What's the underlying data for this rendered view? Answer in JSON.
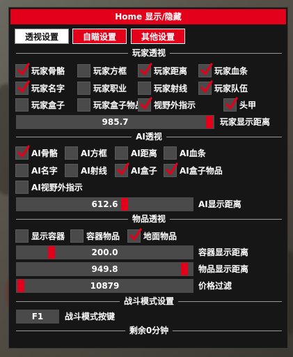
{
  "window": {
    "title": "Home 显示/隐藏"
  },
  "tabs": [
    {
      "label": "透视设置",
      "active": true
    },
    {
      "label": "自瞄设置",
      "active": false
    },
    {
      "label": "其他设置",
      "active": false
    }
  ],
  "player_section": {
    "title": "玩家透视",
    "options": [
      {
        "label": "玩家骨骼",
        "checked": true
      },
      {
        "label": "玩家方框",
        "checked": false
      },
      {
        "label": "玩家距离",
        "checked": true
      },
      {
        "label": "玩家血条",
        "checked": true
      },
      {
        "label": "玩家名字",
        "checked": true
      },
      {
        "label": "玩家职业",
        "checked": false
      },
      {
        "label": "玩家射线",
        "checked": false
      },
      {
        "label": "玩家队伍",
        "checked": true
      },
      {
        "label": "玩家盒子",
        "checked": false
      },
      {
        "label": "玩家盒子物品",
        "checked": false
      },
      {
        "label": "视野外指示",
        "checked": true
      },
      {
        "label": "头甲",
        "checked": true
      }
    ],
    "distance_slider": {
      "value": "985.7",
      "label": "玩家显示距离",
      "fraction": 0.986
    }
  },
  "ai_section": {
    "title": "AI透视",
    "options": [
      {
        "label": "AI骨骼",
        "checked": true
      },
      {
        "label": "AI方框",
        "checked": false
      },
      {
        "label": "AI距离",
        "checked": false
      },
      {
        "label": "AI血条",
        "checked": false
      },
      {
        "label": "AI名字",
        "checked": false
      },
      {
        "label": "AI射线",
        "checked": false
      },
      {
        "label": "AI盒子",
        "checked": true
      },
      {
        "label": "AI盒子物品",
        "checked": true
      },
      {
        "label": "AI视野外指示",
        "checked": false
      }
    ],
    "distance_slider": {
      "value": "612.6",
      "label": "AI显示距离",
      "fraction": 0.613
    }
  },
  "item_section": {
    "title": "物品透视",
    "options": [
      {
        "label": "显示容器",
        "checked": false
      },
      {
        "label": "容器物品",
        "checked": false
      },
      {
        "label": "地面物品",
        "checked": true
      }
    ],
    "container_slider": {
      "value": "200.0",
      "label": "容器显示距离",
      "fraction": 0.2
    },
    "item_slider": {
      "value": "949.8",
      "label": "物品显示距离",
      "fraction": 0.95
    },
    "price_slider": {
      "value": "10879",
      "label": "价格过滤",
      "fraction": 0.02
    }
  },
  "combat_section": {
    "title": "战斗模式设置",
    "key_value": "F1",
    "key_label": "战斗模式按键",
    "remaining": "剩余0分钟"
  },
  "colors": {
    "accent": "#e3001a",
    "panel": "#161616",
    "control": "#4a4a4a",
    "check": "#e3001a"
  }
}
